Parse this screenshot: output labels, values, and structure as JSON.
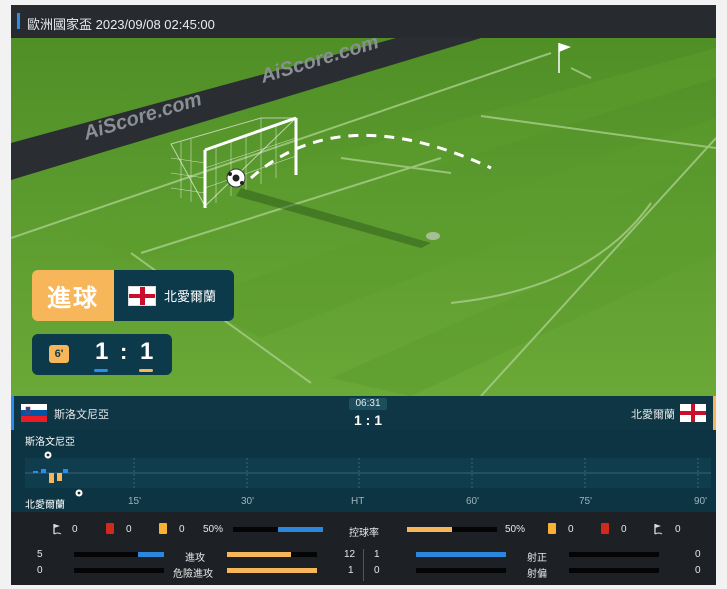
{
  "header": {
    "title": "歐洲國家盃 2023/09/08 02:45:00"
  },
  "watermark": [
    "AiScore.com",
    "AiScore.com"
  ],
  "event": {
    "type_label": "進球",
    "team": "北愛爾蘭",
    "minute": "6'",
    "home_score": "1",
    "separator": ":",
    "away_score": "1"
  },
  "match": {
    "home_team": "斯洛文尼亞",
    "away_team": "北愛爾蘭",
    "clock": "06:31",
    "score": "1 : 1"
  },
  "timeline": {
    "home_label": "斯洛文尼亞",
    "away_label": "北愛爾蘭",
    "ticks": [
      "15'",
      "30'",
      "HT",
      "60'",
      "75'",
      "90'"
    ]
  },
  "stats": {
    "home_corners": "0",
    "home_red": "0",
    "home_yellow": "0",
    "home_possession": "50%",
    "possession_label": "控球率",
    "away_possession": "50%",
    "away_yellow": "0",
    "away_red": "0",
    "away_corners": "0",
    "attack_home": "5",
    "attack_label": "進攻",
    "attack_away": "12",
    "danger_home": "0",
    "danger_label": "危險進攻",
    "danger_away": "1",
    "on_target_home": "1",
    "on_target_label": "射正",
    "on_target_away": "0",
    "off_target_home": "0",
    "off_target_label": "射偏",
    "off_target_away": "0"
  },
  "colors": {
    "home": "#2a8cf0",
    "away": "#f7b65a",
    "pitch": "#5a9a2c"
  }
}
